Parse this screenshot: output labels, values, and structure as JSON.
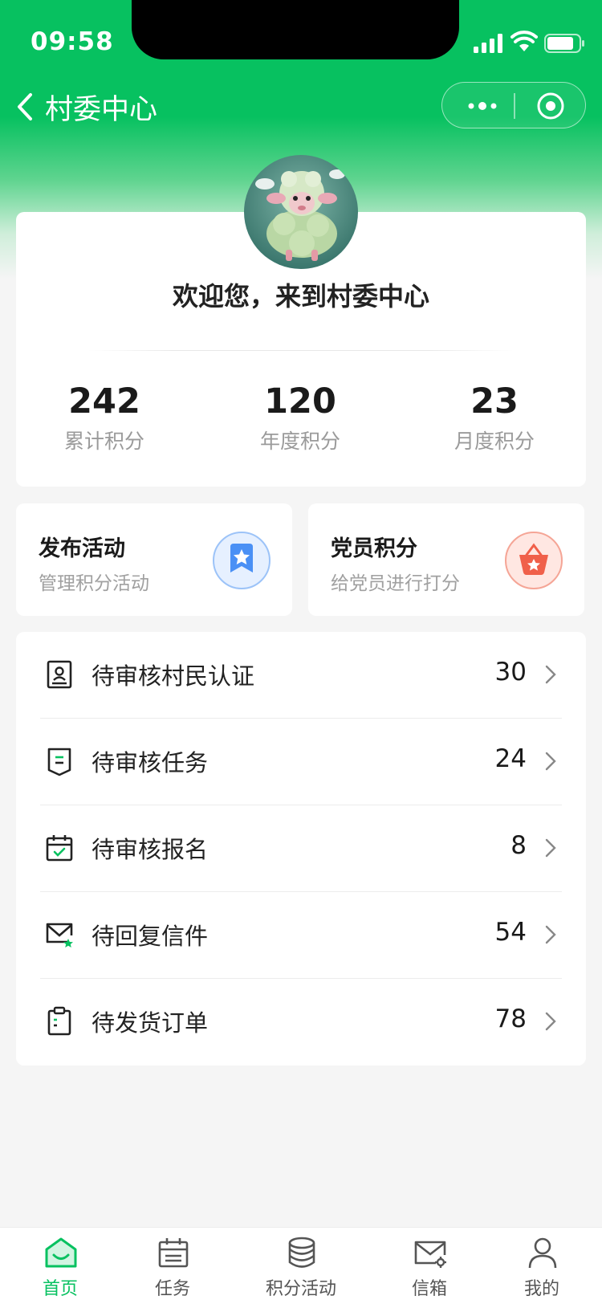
{
  "status_bar": {
    "time": "09:58"
  },
  "nav": {
    "title": "村委中心"
  },
  "profile": {
    "welcome": "欢迎您，来到村委中心",
    "stats": [
      {
        "value": "242",
        "label": "累计积分"
      },
      {
        "value": "120",
        "label": "年度积分"
      },
      {
        "value": "23",
        "label": "月度积分"
      }
    ]
  },
  "quick_actions": [
    {
      "title": "发布活动",
      "subtitle": "管理积分活动",
      "icon": "badge-star-icon",
      "color": "#4a90f5"
    },
    {
      "title": "党员积分",
      "subtitle": "给党员进行打分",
      "icon": "basket-star-icon",
      "color": "#f0604a"
    }
  ],
  "pending": [
    {
      "label": "待审核村民认证",
      "count": "30",
      "icon": "id-card-icon"
    },
    {
      "label": "待审核任务",
      "count": "24",
      "icon": "ribbon-doc-icon"
    },
    {
      "label": "待审核报名",
      "count": "8",
      "icon": "calendar-check-icon"
    },
    {
      "label": "待回复信件",
      "count": "54",
      "icon": "mail-star-icon"
    },
    {
      "label": "待发货订单",
      "count": "78",
      "icon": "clipboard-icon"
    }
  ],
  "tabs": [
    {
      "label": "首页",
      "icon": "home-icon",
      "active": true
    },
    {
      "label": "任务",
      "icon": "calendar-icon",
      "active": false
    },
    {
      "label": "积分活动",
      "icon": "database-icon",
      "active": false
    },
    {
      "label": "信箱",
      "icon": "mail-gear-icon",
      "active": false
    },
    {
      "label": "我的",
      "icon": "user-icon",
      "active": false
    }
  ],
  "colors": {
    "brand": "#07c160",
    "accent_star": "#07c160"
  }
}
